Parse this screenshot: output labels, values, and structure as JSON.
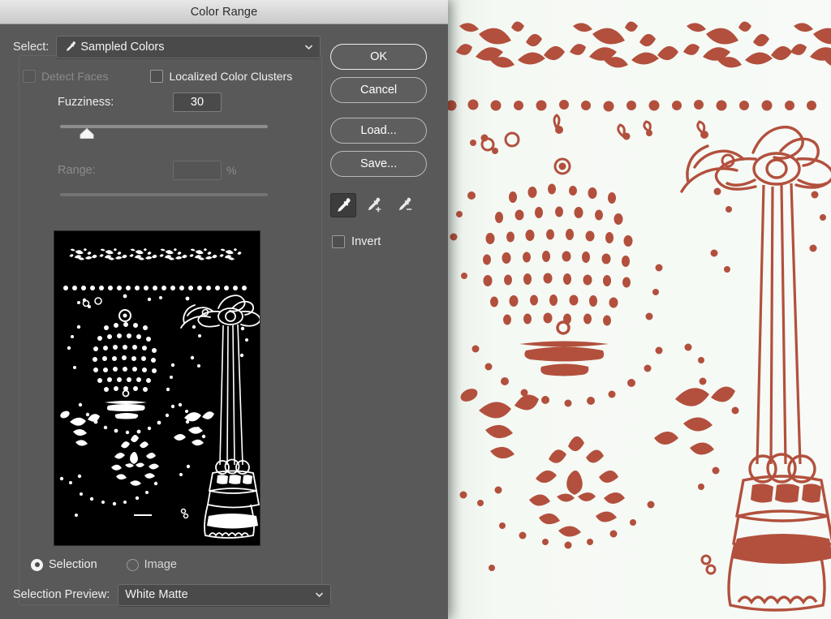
{
  "window": {
    "title": "Color Range"
  },
  "colors": {
    "dialog_bg": "#595959",
    "titlebar_top": "#e8e8e8",
    "titlebar_bottom": "#c9c9c9",
    "field_bg": "#4a4a4a",
    "text": "#f0f0f0",
    "text_disabled": "#8b8b8b",
    "artwork_ink": "#b2503d",
    "artwork_paper": "#f4f8f3",
    "preview_bg": "#000000",
    "preview_fg": "#ffffff"
  },
  "select": {
    "label": "Select:",
    "value": "Sampled Colors",
    "icon": "eyedropper-icon",
    "chevron": "chevron-down-icon",
    "options": [
      "Sampled Colors"
    ]
  },
  "checkboxes": {
    "detect_faces": {
      "label": "Detect Faces",
      "checked": false,
      "enabled": false
    },
    "localized_color_clusters": {
      "label": "Localized Color Clusters",
      "checked": false,
      "enabled": true
    },
    "invert": {
      "label": "Invert",
      "checked": false,
      "enabled": true
    }
  },
  "fuzziness": {
    "label": "Fuzziness:",
    "value": "30",
    "slider_percent": 13,
    "enabled": true
  },
  "range": {
    "label": "Range:",
    "value": "",
    "unit": "%",
    "slider_percent": 0,
    "enabled": false
  },
  "buttons": {
    "ok": "OK",
    "cancel": "Cancel",
    "load": "Load...",
    "save": "Save..."
  },
  "eyedroppers": [
    {
      "name": "eyedropper-icon",
      "mode": "sample",
      "active": true
    },
    {
      "name": "eyedropper-add-icon",
      "mode": "add",
      "active": false
    },
    {
      "name": "eyedropper-subtract-icon",
      "mode": "subtract",
      "active": false
    }
  ],
  "preview_mode": {
    "selection": {
      "label": "Selection",
      "selected": true
    },
    "image": {
      "label": "Image",
      "selected": false
    }
  },
  "selection_preview": {
    "label": "Selection Preview:",
    "value": "White Matte",
    "chevron": "chevron-down-icon",
    "options": [
      "White Matte"
    ]
  }
}
